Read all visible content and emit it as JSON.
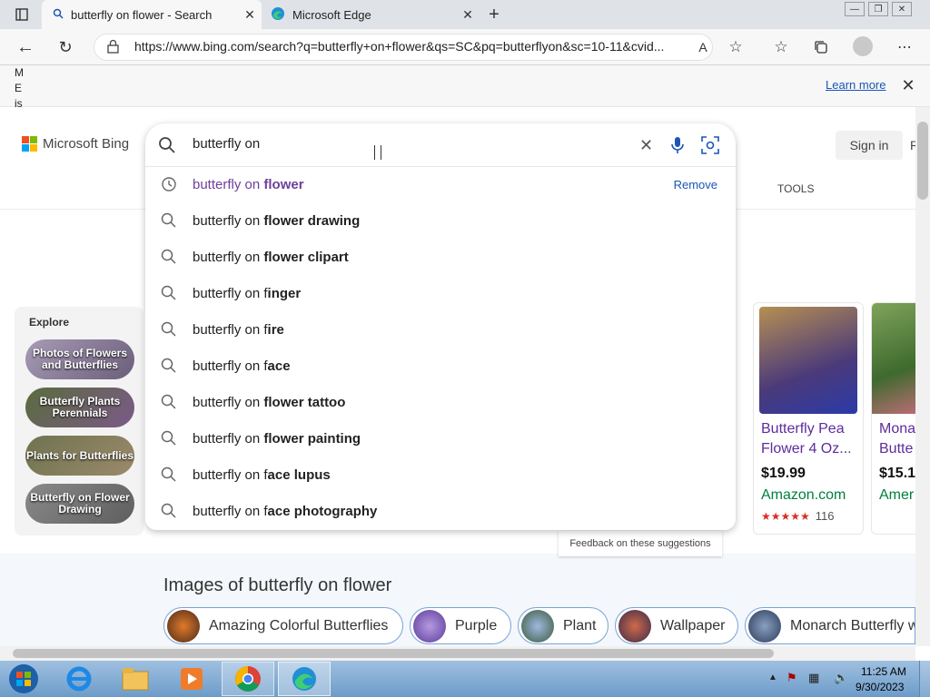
{
  "browser": {
    "tabs": [
      {
        "title": "butterfly on flower - Search",
        "icon": "search-icon"
      },
      {
        "title": "Microsoft Edge",
        "icon": "edge-icon"
      }
    ],
    "url": "https://www.bing.com/search?q=butterfly+on+flower&qs=SC&pq=butterflyon&sc=10-11&cvid...",
    "window_controls": [
      "minimize",
      "restore",
      "close"
    ]
  },
  "infobar": {
    "message": "M E is",
    "link": "Learn more"
  },
  "bing": {
    "brand": "Microsoft Bing",
    "sign_in": "Sign in",
    "tools_tab": "TOOLS",
    "search_query": "butterfly on",
    "suggestions": [
      {
        "prefix": "butterfly on ",
        "bold": "flower",
        "history": true,
        "action": "Remove"
      },
      {
        "prefix": "butterfly on ",
        "bold": "flower drawing"
      },
      {
        "prefix": "butterfly on ",
        "bold": "flower clipart"
      },
      {
        "prefix": "butterfly on f",
        "bold": "inger"
      },
      {
        "prefix": "butterfly on f",
        "bold": "ire"
      },
      {
        "prefix": "butterfly on f",
        "bold": "ace"
      },
      {
        "prefix": "butterfly on ",
        "bold": "flower tattoo"
      },
      {
        "prefix": "butterfly on ",
        "bold": "flower painting"
      },
      {
        "prefix": "butterfly on f",
        "bold": "ace lupus"
      },
      {
        "prefix": "butterfly on f",
        "bold": "ace photography"
      }
    ],
    "feedback": "Feedback on these suggestions"
  },
  "explore": {
    "title": "Explore",
    "items": [
      "Photos of Flowers and Butterflies",
      "Butterfly Plants Perennials",
      "Plants for Butterflies",
      "Butterfly on Flower Drawing"
    ]
  },
  "shopping": [
    {
      "title": "Butterfly Pea Flower 4 Oz...",
      "price": "$19.99",
      "seller": "Amazon.com",
      "rating": "★★★★★",
      "reviews": "116"
    },
    {
      "title": "Mona Butte",
      "price": "$15.1",
      "seller": "Amer"
    }
  ],
  "images": {
    "heading": "Images of butterfly on flower",
    "chips": [
      "Amazing Colorful Butterflies",
      "Purple",
      "Plant",
      "Wallpaper",
      "Monarch Butterfly w"
    ]
  },
  "taskbar": {
    "time": "11:25 AM",
    "date": "9/30/2023"
  },
  "colors": {
    "accent": "#1a56b5",
    "visited": "#6e3f9a",
    "seller": "#00803e"
  }
}
